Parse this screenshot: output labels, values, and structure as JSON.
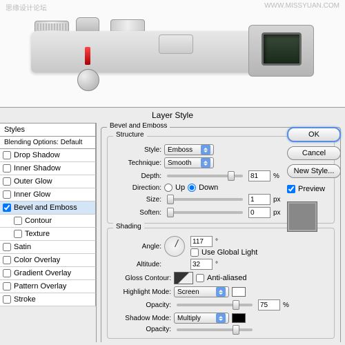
{
  "watermark_right": "WWW.MISSYUAN.COM",
  "watermark_left": "思缘设计论坛",
  "dialog": {
    "title": "Layer Style"
  },
  "styles_panel": {
    "header": "Styles",
    "blending": "Blending Options: Default",
    "items": [
      {
        "label": "Drop Shadow",
        "checked": false
      },
      {
        "label": "Inner Shadow",
        "checked": false
      },
      {
        "label": "Outer Glow",
        "checked": false
      },
      {
        "label": "Inner Glow",
        "checked": false
      },
      {
        "label": "Bevel and Emboss",
        "checked": true,
        "selected": true
      },
      {
        "label": "Contour",
        "checked": false,
        "sub": true
      },
      {
        "label": "Texture",
        "checked": false,
        "sub": true
      },
      {
        "label": "Satin",
        "checked": false
      },
      {
        "label": "Color Overlay",
        "checked": false
      },
      {
        "label": "Gradient Overlay",
        "checked": false
      },
      {
        "label": "Pattern Overlay",
        "checked": false
      },
      {
        "label": "Stroke",
        "checked": false
      }
    ]
  },
  "bevel": {
    "group_title": "Bevel and Emboss",
    "structure_title": "Structure",
    "shading_title": "Shading",
    "style_label": "Style:",
    "style_value": "Emboss",
    "technique_label": "Technique:",
    "technique_value": "Smooth",
    "depth_label": "Depth:",
    "depth_value": "81",
    "depth_unit": "%",
    "direction_label": "Direction:",
    "up_label": "Up",
    "down_label": "Down",
    "size_label": "Size:",
    "size_value": "1",
    "size_unit": "px",
    "soften_label": "Soften:",
    "soften_value": "0",
    "soften_unit": "px",
    "angle_label": "Angle:",
    "angle_value": "117",
    "angle_unit": "°",
    "global_label": "Use Global Light",
    "altitude_label": "Altitude:",
    "altitude_value": "32",
    "altitude_unit": "°",
    "gloss_label": "Gloss Contour:",
    "anti_label": "Anti-aliased",
    "highlight_label": "Highlight Mode:",
    "highlight_value": "Screen",
    "hi_opacity_label": "Opacity:",
    "hi_opacity_value": "75",
    "hi_opacity_unit": "%",
    "shadow_label": "Shadow Mode:",
    "shadow_value": "Multiply",
    "sh_opacity_label": "Opacity:"
  },
  "buttons": {
    "ok": "OK",
    "cancel": "Cancel",
    "new_style": "New Style...",
    "preview": "Preview"
  }
}
